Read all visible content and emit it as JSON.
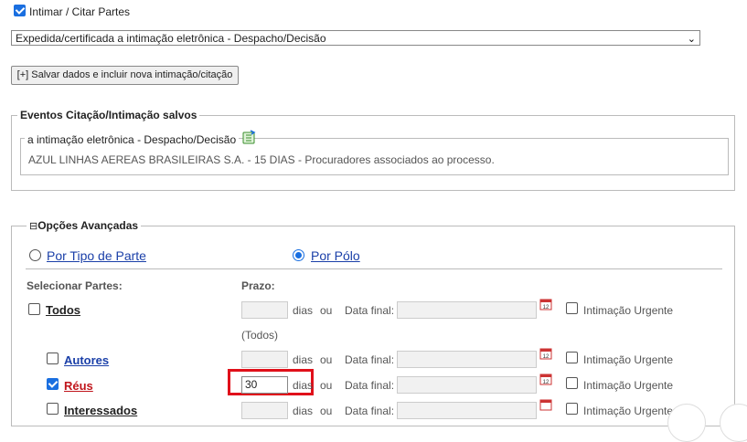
{
  "intimar": {
    "label": "Intimar / Citar Partes",
    "checked": true
  },
  "select": {
    "value": "Expedida/certificada a intimação eletrônica - Despacho/Decisão"
  },
  "add_button": {
    "label": "[+] Salvar dados e incluir nova intimação/citação"
  },
  "eventos": {
    "legend": "Eventos Citação/Intimação salvos",
    "inner_legend": "a intimação eletrônica - Despacho/Decisão",
    "content": "AZUL LINHAS AEREAS BRASILEIRAS S.A. - 15 DIAS - Procuradores associados ao processo."
  },
  "opcoes": {
    "legend": "Opções Avançadas",
    "collapse_glyph": "⊟",
    "radio_tipo": "Por Tipo de Parte",
    "radio_polo": "Por Pólo",
    "selected": "polo"
  },
  "table": {
    "col_partes": "Selecionar Partes:",
    "col_prazo": "Prazo:",
    "dias": "dias",
    "ou": "ou",
    "data_final": "Data final:",
    "urgente": "Intimação Urgente",
    "todos_note": "(Todos)",
    "rows": [
      {
        "label": "Todos",
        "checked": false,
        "prazo": ""
      },
      {
        "label": "Autores",
        "checked": false,
        "prazo": ""
      },
      {
        "label": "Réus",
        "checked": true,
        "prazo": "30"
      },
      {
        "label": "Interessados",
        "checked": false,
        "prazo": ""
      }
    ]
  },
  "colors": {
    "link_blue": "#1a3fa8",
    "link_red": "#c0161c",
    "highlight": "#e0101a",
    "accent": "#1a6fe0"
  }
}
